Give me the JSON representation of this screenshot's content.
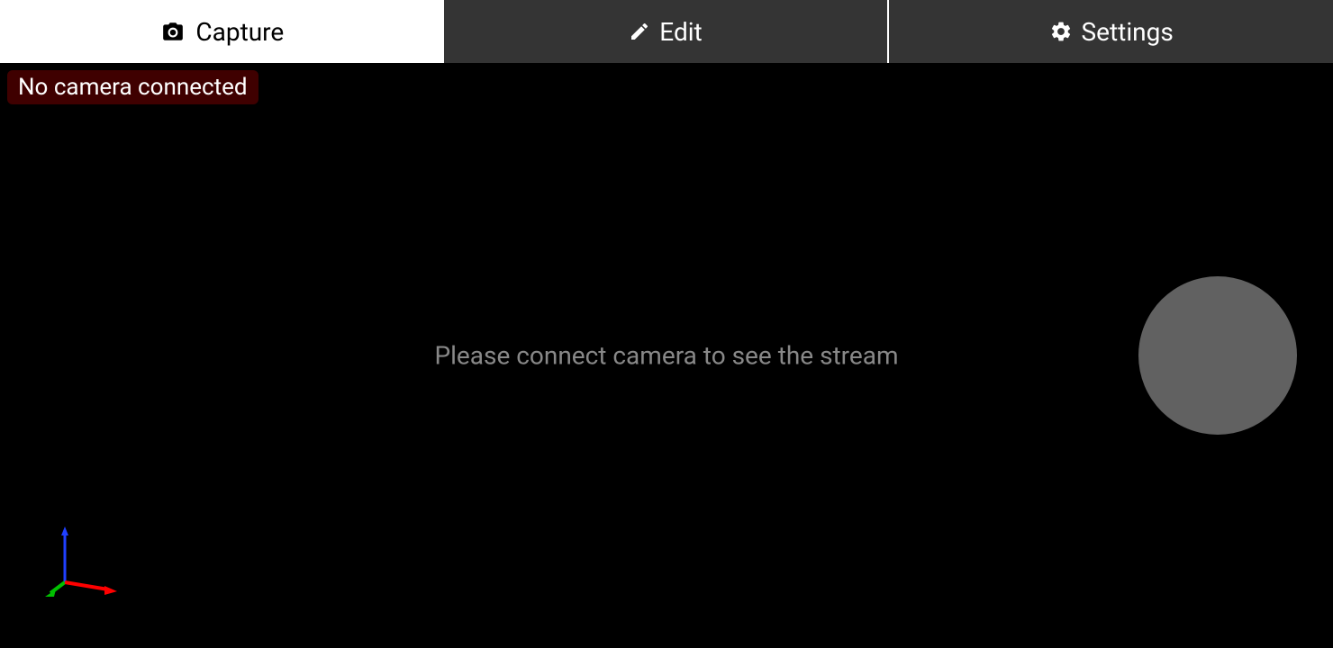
{
  "tabs": {
    "capture": {
      "label": "Capture"
    },
    "edit": {
      "label": "Edit"
    },
    "settings": {
      "label": "Settings"
    }
  },
  "status": {
    "camera_message": "No camera connected"
  },
  "viewport": {
    "placeholder_message": "Please connect camera to see the stream"
  }
}
